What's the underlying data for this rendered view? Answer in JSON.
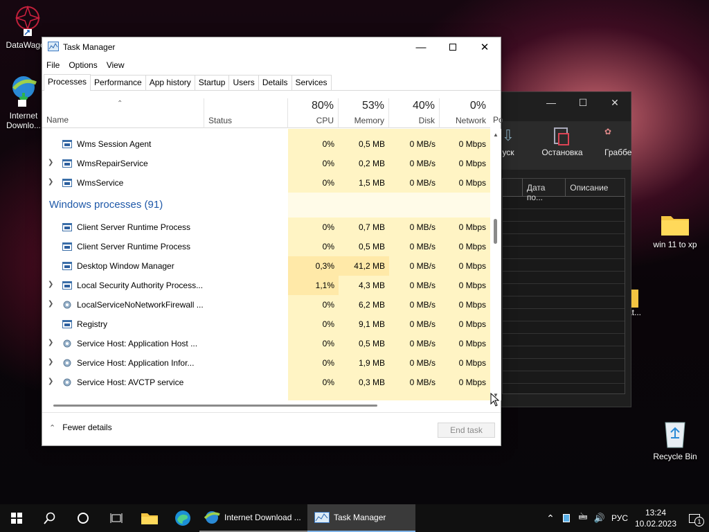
{
  "desktop": {
    "icons": [
      {
        "label": "DataWagon"
      },
      {
        "label": "Internet Downlo..."
      },
      {
        "label": "win 11 to xp"
      },
      {
        "label": "Recycle Bin"
      },
      {
        "label": "at..."
      }
    ]
  },
  "bg_window": {
    "tools": [
      "уск",
      "Остановка",
      "Граббе"
    ],
    "columns": [
      "Дата по...",
      "Описание"
    ]
  },
  "task_manager": {
    "title": "Task Manager",
    "menu": [
      "File",
      "Options",
      "View"
    ],
    "tabs": [
      "Processes",
      "Performance",
      "App history",
      "Startup",
      "Users",
      "Details",
      "Services"
    ],
    "active_tab": "Processes",
    "header": {
      "name": "Name",
      "status": "Status",
      "cpu": {
        "pct": "80%",
        "label": "CPU"
      },
      "memory": {
        "pct": "53%",
        "label": "Memory"
      },
      "disk": {
        "pct": "40%",
        "label": "Disk"
      },
      "network": {
        "pct": "0%",
        "label": "Network"
      },
      "power": "Po"
    },
    "rows": [
      {
        "type": "proc",
        "expand": false,
        "name": "Wms Session Agent",
        "cpu": "0%",
        "mem": "0,5 MB",
        "disk": "0 MB/s",
        "net": "0 Mbps"
      },
      {
        "type": "proc",
        "expand": true,
        "name": "WmsRepairService",
        "cpu": "0%",
        "mem": "0,2 MB",
        "disk": "0 MB/s",
        "net": "0 Mbps"
      },
      {
        "type": "proc",
        "expand": true,
        "name": "WmsService",
        "cpu": "0%",
        "mem": "1,5 MB",
        "disk": "0 MB/s",
        "net": "0 Mbps"
      },
      {
        "type": "group",
        "name": "Windows processes (91)"
      },
      {
        "type": "proc",
        "expand": false,
        "name": "Client Server Runtime Process",
        "cpu": "0%",
        "mem": "0,7 MB",
        "disk": "0 MB/s",
        "net": "0 Mbps"
      },
      {
        "type": "proc",
        "expand": false,
        "name": "Client Server Runtime Process",
        "cpu": "0%",
        "mem": "0,5 MB",
        "disk": "0 MB/s",
        "net": "0 Mbps"
      },
      {
        "type": "proc",
        "expand": false,
        "name": "Desktop Window Manager",
        "cpu": "0,3%",
        "mem": "41,2 MB",
        "disk": "0 MB/s",
        "net": "0 Mbps"
      },
      {
        "type": "proc",
        "expand": true,
        "name": "Local Security Authority Process...",
        "cpu": "1,1%",
        "mem": "4,3 MB",
        "disk": "0 MB/s",
        "net": "0 Mbps"
      },
      {
        "type": "proc",
        "expand": true,
        "gear": true,
        "name": "LocalServiceNoNetworkFirewall ...",
        "cpu": "0%",
        "mem": "6,2 MB",
        "disk": "0 MB/s",
        "net": "0 Mbps"
      },
      {
        "type": "proc",
        "expand": false,
        "name": "Registry",
        "cpu": "0%",
        "mem": "9,1 MB",
        "disk": "0 MB/s",
        "net": "0 Mbps"
      },
      {
        "type": "proc",
        "expand": true,
        "gear": true,
        "name": "Service Host: Application Host ...",
        "cpu": "0%",
        "mem": "0,5 MB",
        "disk": "0 MB/s",
        "net": "0 Mbps"
      },
      {
        "type": "proc",
        "expand": true,
        "gear": true,
        "name": "Service Host: Application Infor...",
        "cpu": "0%",
        "mem": "1,9 MB",
        "disk": "0 MB/s",
        "net": "0 Mbps"
      },
      {
        "type": "proc",
        "expand": true,
        "gear": true,
        "name": "Service Host: AVCTP service",
        "cpu": "0%",
        "mem": "0,3 MB",
        "disk": "0 MB/s",
        "net": "0 Mbps"
      }
    ],
    "footer": {
      "fewer_details": "Fewer details",
      "end_task": "End task"
    }
  },
  "taskbar": {
    "apps": [
      "Internet Download ...",
      "Task Manager"
    ],
    "lang": "РУС",
    "time": "13:24",
    "date": "10.02.2023",
    "notif_count": "1"
  },
  "colors": {
    "heat_light": "#fff4c4",
    "heat_mid": "#ffe9a8",
    "accent": "#1e58a8"
  }
}
